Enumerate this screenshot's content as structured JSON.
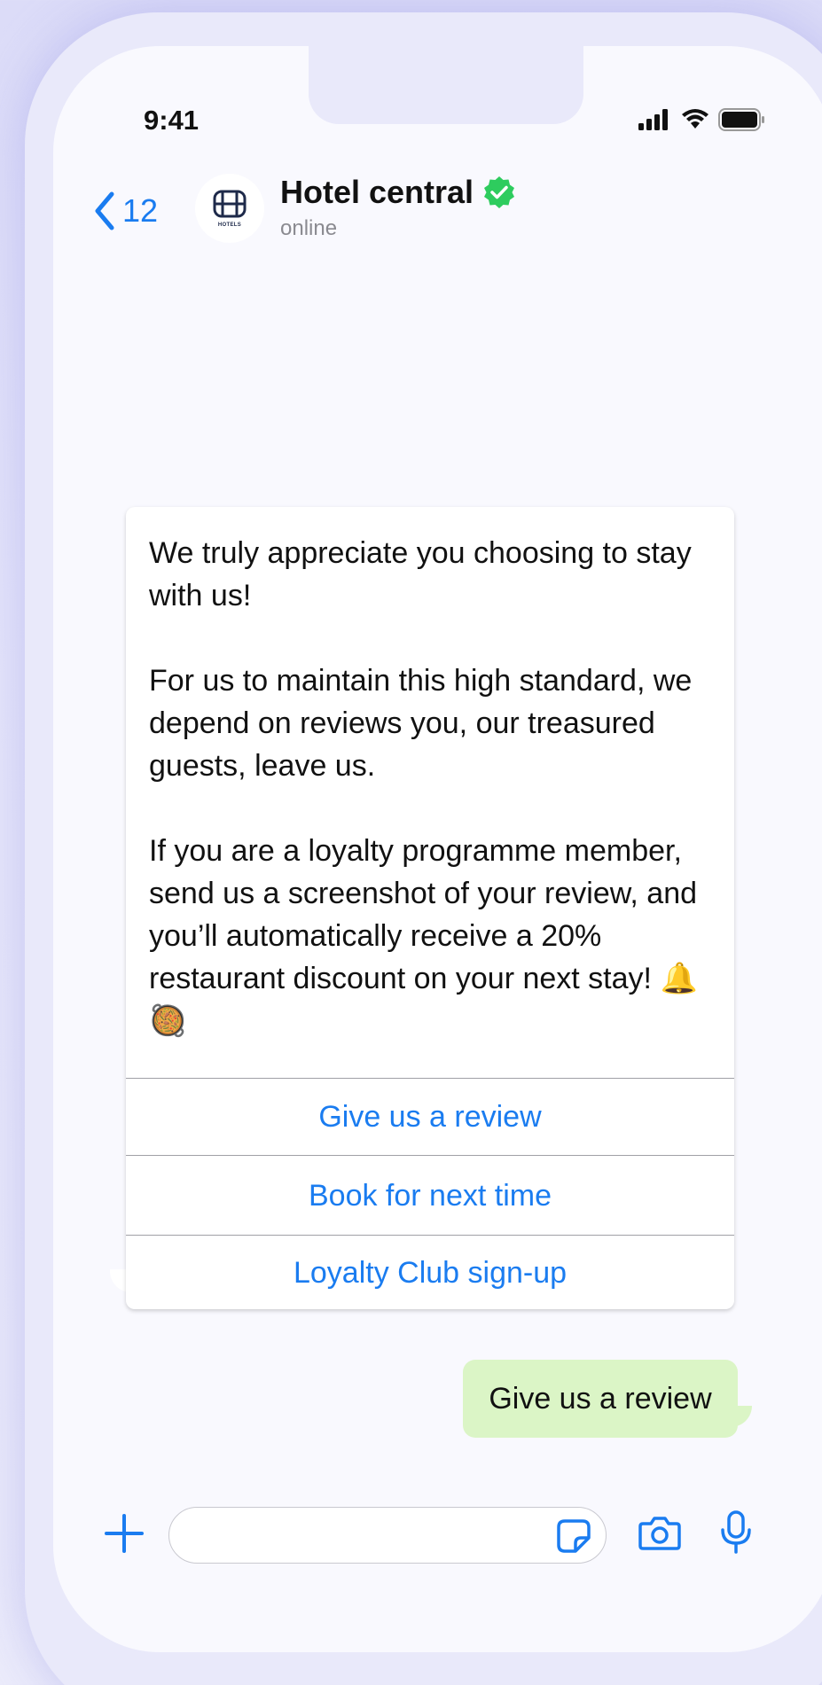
{
  "status_bar": {
    "time": "9:41"
  },
  "header": {
    "back_count": "12",
    "avatar_text": "HOTELS",
    "title": "Hotel central",
    "subtitle": "online"
  },
  "message": {
    "paragraphs": [
      "We truly appreciate you choosing to stay with us!",
      "For us to maintain this high standard, we depend on reviews you, our treasured guests, leave us.",
      "If you are a loyalty programme member, send us a screenshot of your review, and you’ll automatically receive a 20% restaurant discount on your next stay!"
    ],
    "emojis": "🔔🥘",
    "actions": [
      "Give us a review",
      "Book for next time",
      "Loyalty Club sign-up"
    ]
  },
  "reply": {
    "text": "Give us a review"
  },
  "colors": {
    "accent": "#1a7cf0",
    "verified": "#2ecc5e",
    "outgoing_bubble": "#dbf5c6"
  }
}
